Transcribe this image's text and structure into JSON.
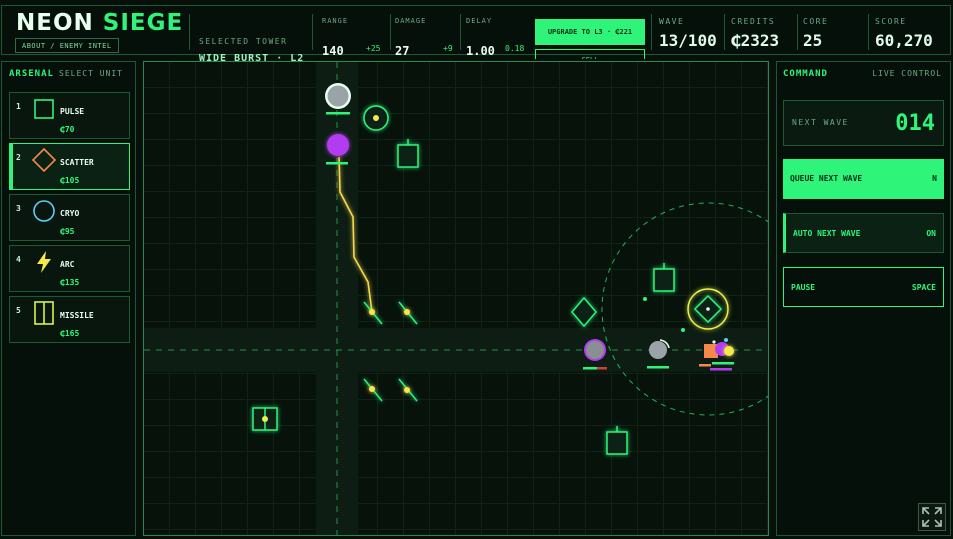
{
  "header": {
    "logo_word1": "NEON",
    "logo_word2": "SIEGE",
    "about_label": "ABOUT / ENEMY INTEL",
    "selected_tower_label": "SELECTED TOWER",
    "selected_tower_name": "WIDE BURST · L2",
    "stats": {
      "range": {
        "label": "RANGE",
        "value": "140",
        "delta": "+25"
      },
      "damage": {
        "label": "DAMAGE",
        "value": "27",
        "delta": "+9"
      },
      "delay": {
        "label": "DELAY",
        "value": "1.00",
        "delta": "0.18"
      }
    },
    "upgrade_label": "UPGRADE TO L3 · ₵221",
    "sell_label": "SELL",
    "wave": {
      "label": "WAVE",
      "value": "13/100"
    },
    "credits": {
      "label": "CREDITS",
      "value": "₵2323"
    },
    "core": {
      "label": "CORE",
      "value": "25"
    },
    "score": {
      "label": "SCORE",
      "value": "60,270"
    }
  },
  "arsenal": {
    "title": "ARSENAL",
    "subtitle": "SELECT UNIT",
    "units": [
      {
        "num": "1",
        "name": "PULSE",
        "cost": "₵70",
        "icon": "square-icon",
        "color": "#2ef57a",
        "selected": false
      },
      {
        "num": "2",
        "name": "SCATTER",
        "cost": "₵105",
        "icon": "diamond-icon",
        "color": "#f5894a",
        "selected": true
      },
      {
        "num": "3",
        "name": "CRYO",
        "cost": "₵95",
        "icon": "circle-icon",
        "color": "#5ad2f5",
        "selected": false
      },
      {
        "num": "4",
        "name": "ARC",
        "cost": "₵135",
        "icon": "lightning-icon",
        "color": "#f5e84a",
        "selected": false
      },
      {
        "num": "5",
        "name": "MISSILE",
        "cost": "₵165",
        "icon": "missile-icon",
        "color": "#d6f54a",
        "selected": false
      }
    ]
  },
  "command": {
    "title": "COMMAND",
    "live": "LIVE CONTROL",
    "next_wave_label": "NEXT WAVE",
    "next_wave_value": "014",
    "queue": {
      "label": "QUEUE NEXT WAVE",
      "key": "N"
    },
    "auto": {
      "label": "AUTO NEXT WAVE",
      "state": "ON"
    },
    "pause": {
      "label": "PAUSE",
      "key": "SPACE"
    }
  },
  "colors": {
    "accent": "#2ef57a",
    "enemy_purple": "#b23cf0",
    "enemy_grey": "#9aa3a8",
    "lightning": "#f5d84a"
  }
}
